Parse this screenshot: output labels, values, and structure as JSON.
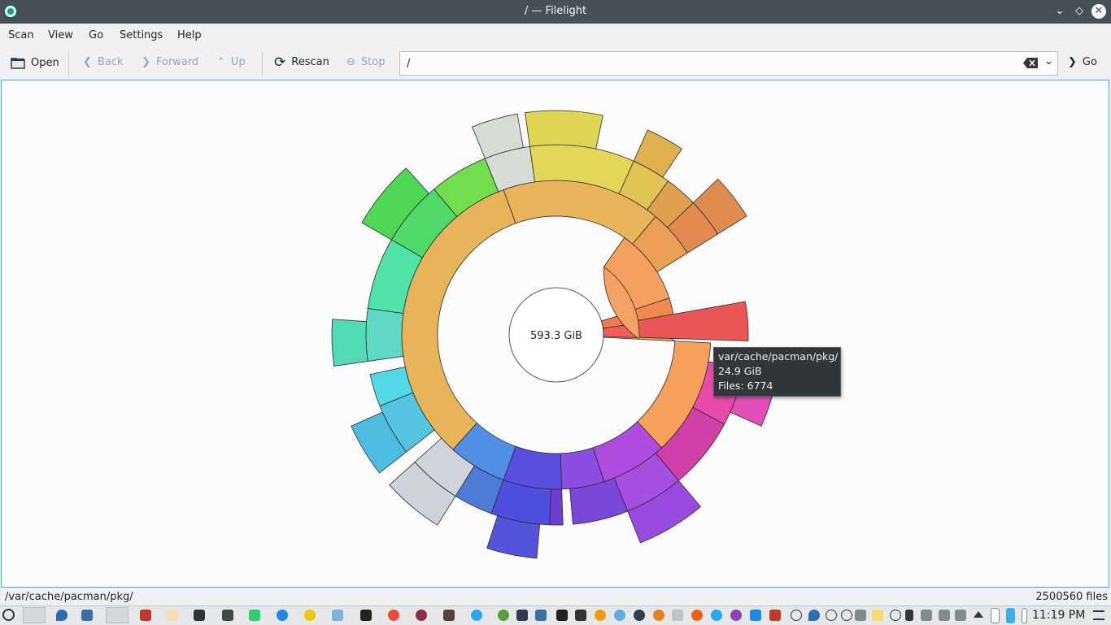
{
  "window": {
    "title": "/ — Filelight"
  },
  "menu": [
    "Scan",
    "View",
    "Go",
    "Settings",
    "Help"
  ],
  "toolbar": {
    "open": "Open",
    "back": "Back",
    "forward": "Forward",
    "up": "Up",
    "rescan": "Rescan",
    "stop": "Stop",
    "url_value": "/",
    "go": "Go"
  },
  "chart": {
    "center_label": "593.3 GiB"
  },
  "tooltip": {
    "path": "var/cache/pacman/pkg/",
    "size": "24.9 GiB",
    "files": "Files: 6774"
  },
  "status": {
    "path": "/var/cache/pacman/pkg/",
    "files": "2500560 files"
  },
  "taskbar": {
    "clock": "11:19 PM"
  },
  "colors": {
    "accent": "#3daee9",
    "titlebar": "#475057",
    "tooltip_bg": "#31363b"
  }
}
